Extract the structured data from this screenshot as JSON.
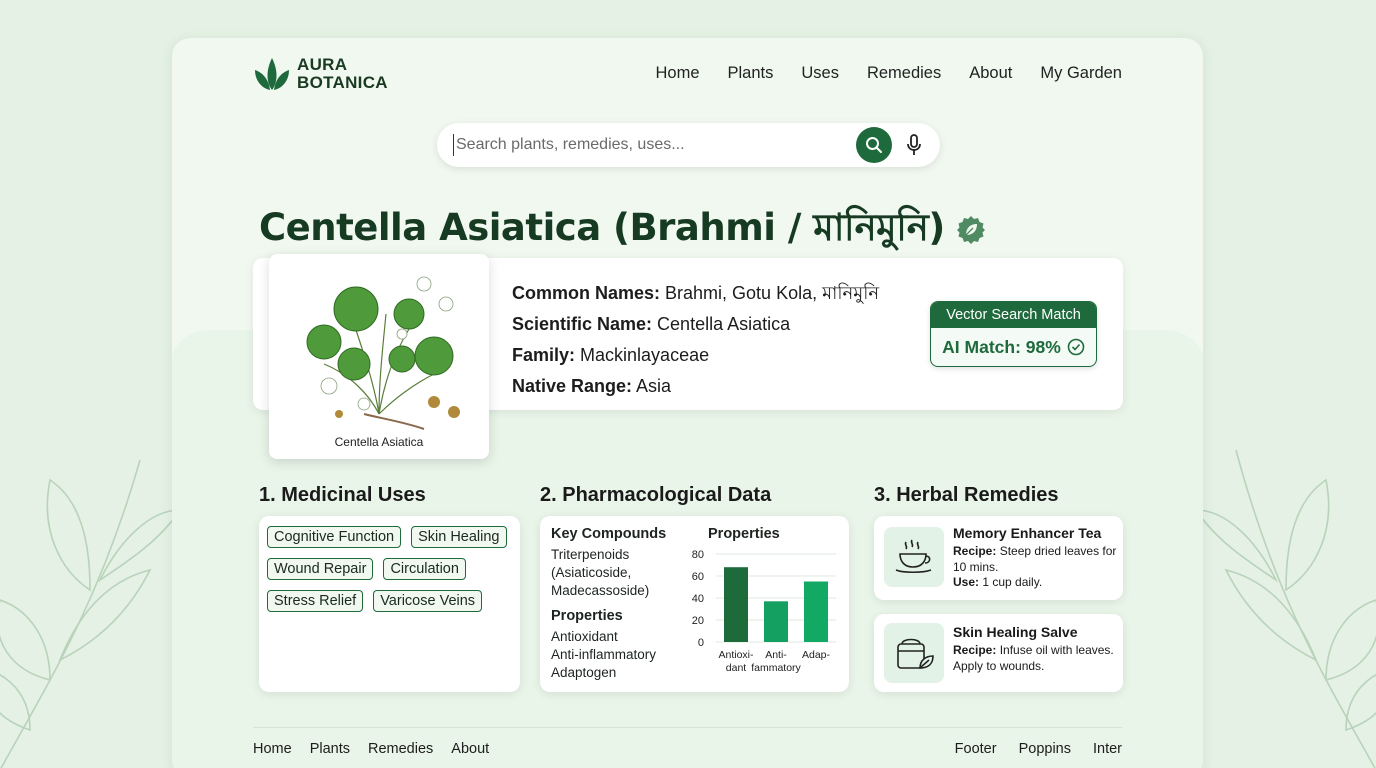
{
  "brand": {
    "line1": "AURA",
    "line2": "BOTANICA"
  },
  "nav": [
    "Home",
    "Plants",
    "Uses",
    "Remedies",
    "About",
    "My Garden"
  ],
  "search": {
    "placeholder": "Search plants, remedies, uses..."
  },
  "title": "Centella Asiatica (Brahmi / মানিমুনি)",
  "plant_image_caption": "Centella Asiatica",
  "info": [
    {
      "label": "Common Names:",
      "value": " Brahmi, Gotu Kola, মানিমুনি"
    },
    {
      "label": "Scientific Name:",
      "value": " Centella Asiatica"
    },
    {
      "label": "Family:",
      "value": " Mackinlayaceae"
    },
    {
      "label": "Native Range:",
      "value": " Asia"
    }
  ],
  "match_badge": {
    "header": "Vector Search Match",
    "value": "AI Match: 98%"
  },
  "sections": {
    "uses": "1. Medicinal Uses",
    "pharm": "2. Pharmacological Data",
    "remedies": "3. Herbal Remedies"
  },
  "medicinal_uses": [
    "Cognitive Function",
    "Skin Healing",
    "Wound Repair",
    "Circulation",
    "Stress Relief",
    "Varicose Veins"
  ],
  "pharm": {
    "compounds_heading": "Key Compounds",
    "compounds_text": [
      "Triterpenoids",
      "(Asiaticoside,",
      "Madecassoside)"
    ],
    "properties_heading": "Properties",
    "properties_list": [
      "Antioxidant",
      "Anti-inflammatory",
      "Adaptogen"
    ],
    "chart_heading": "Properties"
  },
  "chart_data": {
    "type": "bar",
    "title": "Properties",
    "categories": [
      [
        "Antioxi-",
        "dant"
      ],
      [
        "Anti-",
        "fammatory"
      ],
      [
        "Adap-",
        ""
      ]
    ],
    "values": [
      68,
      37,
      55
    ],
    "ylim": [
      0,
      80
    ],
    "yticks": [
      0,
      20,
      40,
      60,
      80
    ],
    "colors": [
      "#1d6b3a",
      "#14a061",
      "#12a964"
    ]
  },
  "remedies": [
    {
      "name": "Memory Enhancer Tea",
      "recipe_label": "Recipe:",
      "recipe": " Steep dried leaves for 10 mins.",
      "use_label": "Use:",
      "use": " 1 cup daily.",
      "icon": "tea-cup-icon"
    },
    {
      "name": "Skin Healing Salve",
      "recipe_label": "Recipe:",
      "recipe": " Infuse oil with leaves. Apply to wounds.",
      "use_label": "",
      "use": "",
      "icon": "salve-jar-icon"
    }
  ],
  "footer": {
    "links": [
      "Home",
      "Plants",
      "Remedies",
      "About"
    ],
    "right": [
      "Footer",
      "Poppins",
      "Inter"
    ]
  },
  "colors": {
    "accent": "#1e6a3c",
    "background": "#e4f1e4"
  }
}
